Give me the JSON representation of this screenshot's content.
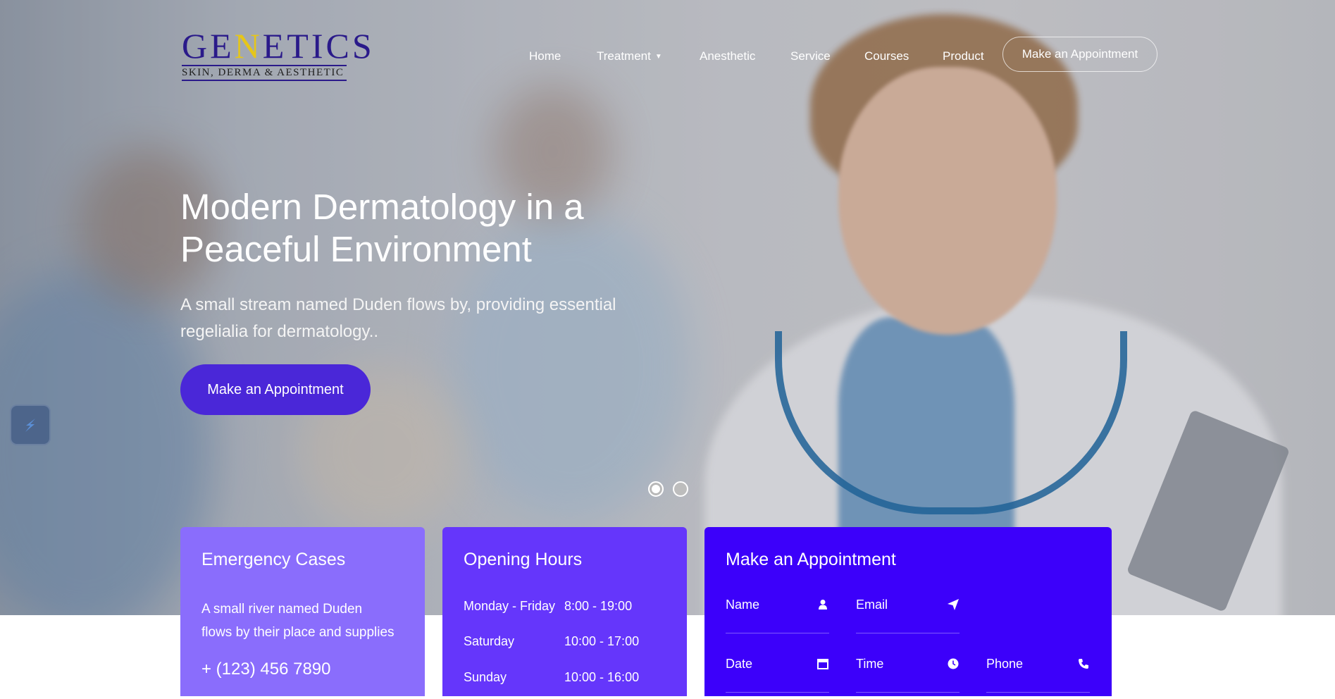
{
  "brand": {
    "logo_prefix": "GE",
    "logo_zig": "N",
    "logo_suffix": "ETICS",
    "logo_tagline": "Skin, Derma & Aesthetic",
    "accent": "#4a27d8"
  },
  "nav": {
    "items": [
      {
        "label": "Home"
      },
      {
        "label": "Treatment",
        "has_dropdown": true
      },
      {
        "label": "Anesthetic"
      },
      {
        "label": "Service"
      },
      {
        "label": "Courses"
      },
      {
        "label": "Product"
      }
    ],
    "cta_label": "Make an Appointment"
  },
  "hero": {
    "title_line1": "Modern Dermatology in a",
    "title_line2": "Peaceful Environment",
    "subtitle_line1": "A small stream named Duden flows by, providing essential",
    "subtitle_line2": "regelialia for dermatology..",
    "cta_label": "Make an Appointment",
    "slides_total": 2,
    "active_slide": 1
  },
  "emergency": {
    "title": "Emergency Cases",
    "desc_line1": "A small river named Duden",
    "desc_line2": "flows by their place and supplies",
    "phone": "+ (123) 456 7890",
    "color": "#8a6dfc"
  },
  "hours": {
    "title": "Opening Hours",
    "rows": [
      {
        "day": "Monday - Friday",
        "time": "8:00 - 19:00"
      },
      {
        "day": "Saturday",
        "time": "10:00 - 17:00"
      },
      {
        "day": "Sunday",
        "time": "10:00 - 16:00"
      }
    ],
    "color": "#6536fb"
  },
  "appointment": {
    "title": "Make an Appointment",
    "fields": {
      "name": {
        "label": "Name",
        "icon": "user-icon"
      },
      "email": {
        "label": "Email",
        "icon": "paper-plane-icon"
      },
      "date": {
        "label": "Date",
        "icon": "calendar-icon"
      },
      "time": {
        "label": "Time",
        "icon": "clock-icon"
      },
      "phone": {
        "label": "Phone",
        "icon": "phone-icon"
      }
    },
    "color": "#3c00fa"
  }
}
